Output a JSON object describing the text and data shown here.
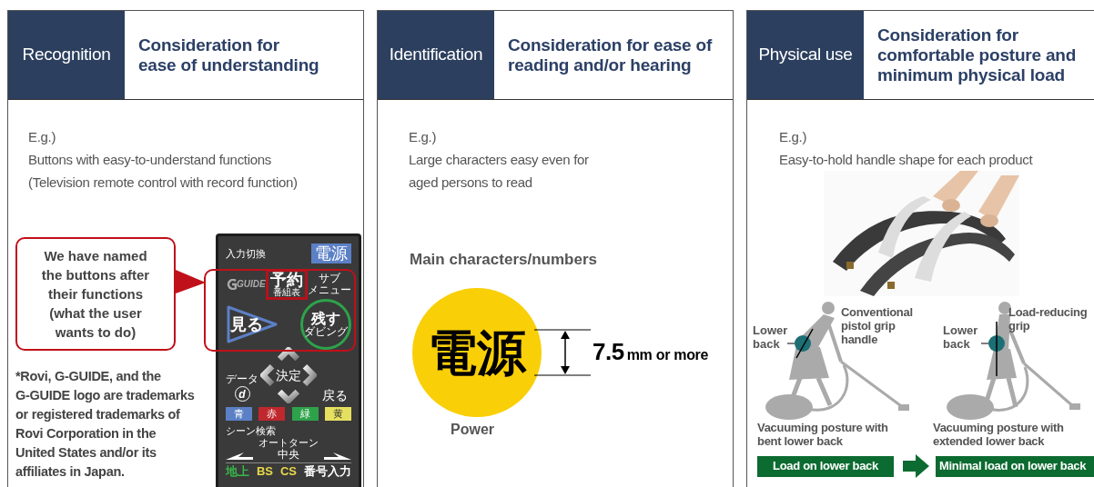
{
  "panels": [
    {
      "kind": "remote",
      "category": "Recognition",
      "heading_lines": [
        "Consideration for",
        "ease of understanding"
      ],
      "example_label": "E.g.)",
      "example_lines": [
        "Buttons with easy-to-understand functions",
        "(Television remote control with record function)"
      ],
      "callout_lines": [
        "We have named",
        "the buttons after",
        "their functions",
        "(what the user",
        "wants to do)"
      ],
      "footnote_lines": [
        "*Rovi, G-GUIDE, and the",
        "G-GUIDE logo are trademarks",
        "or registered trademarks of",
        "Rovi Corporation in the",
        "United States and/or its",
        "affiliates in Japan."
      ],
      "remote": {
        "input_switch": "入力切換",
        "power": "電源",
        "guide_logo": "GUIDE",
        "reserve": "予約",
        "reserve_sub": "番組表",
        "sub_menu_lines": [
          "サブ",
          "メニュー"
        ],
        "view": "見る",
        "keep": "残す",
        "keep_sub": "ダビング",
        "enter": "決定",
        "data": "データ",
        "data_key": "d",
        "back": "戻る",
        "color_keys": [
          {
            "label": "青",
            "color": "#5b80c6",
            "dark_label": false
          },
          {
            "label": "赤",
            "color": "#c0282d",
            "dark_label": false
          },
          {
            "label": "緑",
            "color": "#2ea24a",
            "dark_label": false
          },
          {
            "label": "黄",
            "color": "#e6e060",
            "dark_label": true
          }
        ],
        "scene_search": "シーン検索",
        "auto_turn": "オートターン",
        "center": "中央",
        "broadcast_keys": [
          {
            "label": "地上",
            "color": "#39b54a"
          },
          {
            "label": "BS",
            "color": "#e8d84a"
          },
          {
            "label": "CS",
            "color": "#e8d84a"
          },
          {
            "label": "番号入力",
            "color": "#ffffff"
          }
        ]
      }
    },
    {
      "kind": "characters",
      "category": "Identification",
      "heading_lines": [
        "Consideration for ease of",
        "reading and/or hearing"
      ],
      "example_label": "E.g.)",
      "example_lines": [
        "Large characters easy even for",
        "aged persons to read"
      ],
      "subheading": "Main characters/numbers",
      "symbol": "電源",
      "size_value": "7.5",
      "size_unit": "mm or more",
      "symbol_caption": "Power"
    },
    {
      "kind": "posture",
      "category": "Physical use",
      "heading_lines": [
        "Consideration for",
        "comfortable posture and",
        "minimum physical load"
      ],
      "example_label": "E.g.)",
      "example_lines": [
        "Easy-to-hold handle shape for each product"
      ],
      "figures": [
        {
          "kind": "bent",
          "lower_back_lines": [
            "Lower",
            "back"
          ],
          "grip_lines": [
            "Conventional",
            "pistol grip",
            "handle"
          ],
          "caption_lines": [
            "Vacuuming posture with",
            "bent lower back"
          ],
          "result": "Load on lower back"
        },
        {
          "kind": "upright",
          "lower_back_lines": [
            "Lower",
            "back"
          ],
          "grip_lines": [
            "Load-reducing",
            "grip"
          ],
          "caption_lines": [
            "Vacuuming posture with",
            "extended lower back"
          ],
          "result": "Minimal load on lower back"
        }
      ]
    }
  ]
}
